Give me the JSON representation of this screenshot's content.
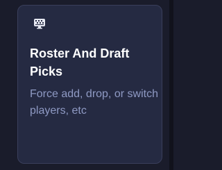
{
  "card": {
    "icon": "monitor-icon",
    "title": "Roster And Draft Picks",
    "description": "Force add, drop, or switch players, etc"
  },
  "colors": {
    "background": "#1a1c2b",
    "card_background": "#252a42",
    "card_border": "#3a3f5c",
    "title": "#ffffff",
    "description": "#8f9ac4"
  }
}
